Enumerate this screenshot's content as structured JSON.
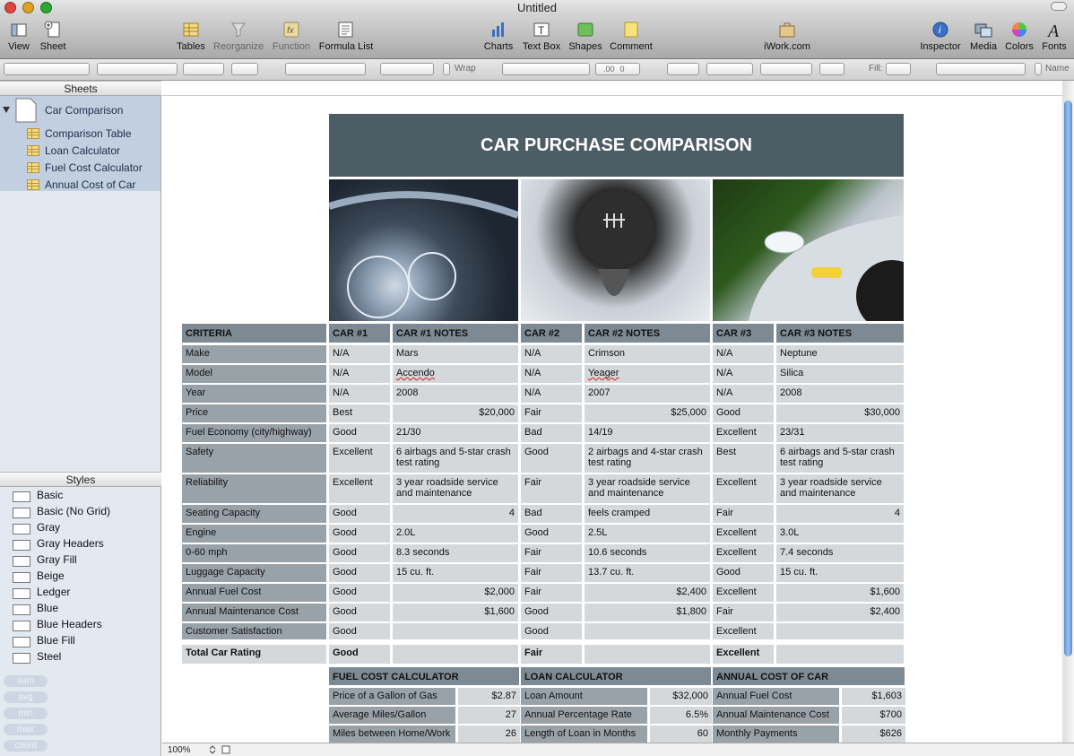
{
  "window": {
    "title": "Untitled"
  },
  "toolbar": {
    "view": "View",
    "sheet": "Sheet",
    "tables": "Tables",
    "reorganize": "Reorganize",
    "function": "Function",
    "formula_list": "Formula List",
    "charts": "Charts",
    "text_box": "Text Box",
    "shapes": "Shapes",
    "comment": "Comment",
    "iwork": "iWork.com",
    "inspector": "Inspector",
    "media": "Media",
    "colors": "Colors",
    "fonts": "Fonts"
  },
  "formatbar": {
    "wrap": "Wrap",
    "fill": "Fill:",
    "name": "Name",
    "decimals": "0",
    "dec_places": ".00"
  },
  "sidebar": {
    "sheets_header": "Sheets",
    "sheet_name": "Car Comparison",
    "tables": [
      "Comparison Table",
      "Loan Calculator",
      "Fuel Cost Calculator",
      "Annual Cost of Car"
    ],
    "styles_header": "Styles",
    "styles": [
      "Basic",
      "Basic (No Grid)",
      "Gray",
      "Gray Headers",
      "Gray Fill",
      "Beige",
      "Ledger",
      "Blue",
      "Blue Headers",
      "Blue Fill",
      "Steel"
    ],
    "functions": [
      "sum",
      "avg",
      "min",
      "max",
      "count"
    ]
  },
  "doc": {
    "title": "CAR PURCHASE COMPARISON",
    "headers": [
      "CRITERIA",
      "CAR #1",
      "CAR #1 NOTES",
      "CAR #2",
      "CAR #2 NOTES",
      "CAR #3",
      "CAR #3 NOTES"
    ],
    "rows": [
      {
        "criteria": "Make",
        "c1": "N/A",
        "n1": "Mars",
        "c2": "N/A",
        "n2": "Crimson",
        "c3": "N/A",
        "n3": "Neptune"
      },
      {
        "criteria": "Model",
        "c1": "N/A",
        "n1": "Accendo",
        "c2": "N/A",
        "n2": "Yeager",
        "c3": "N/A",
        "n3": "Silica"
      },
      {
        "criteria": "Year",
        "c1": "N/A",
        "n1": "2008",
        "c2": "N/A",
        "n2": "2007",
        "c3": "N/A",
        "n3": "2008"
      },
      {
        "criteria": "Price",
        "c1": "Best",
        "n1": "$20,000",
        "c2": "Fair",
        "n2": "$25,000",
        "c3": "Good",
        "n3": "$30,000"
      },
      {
        "criteria": "Fuel Economy (city/highway)",
        "c1": "Good",
        "n1": "21/30",
        "c2": "Bad",
        "n2": "14/19",
        "c3": "Excellent",
        "n3": "23/31"
      },
      {
        "criteria": "Safety",
        "c1": "Excellent",
        "n1": "6 airbags and 5-star crash test rating",
        "c2": "Good",
        "n2": "2 airbags and 4-star crash test rating",
        "c3": "Best",
        "n3": "6 airbags and 5-star crash test rating"
      },
      {
        "criteria": "Reliability",
        "c1": "Excellent",
        "n1": "3 year roadside service and maintenance",
        "c2": "Fair",
        "n2": "3 year roadside service and maintenance",
        "c3": "Excellent",
        "n3": "3 year roadside service and maintenance"
      },
      {
        "criteria": "Seating Capacity",
        "c1": "Good",
        "n1": "4",
        "c2": "Bad",
        "n2": "feels cramped",
        "c3": "Fair",
        "n3": "4"
      },
      {
        "criteria": "Engine",
        "c1": "Good",
        "n1": "2.0L",
        "c2": "Good",
        "n2": "2.5L",
        "c3": "Excellent",
        "n3": "3.0L"
      },
      {
        "criteria": "0-60 mph",
        "c1": "Good",
        "n1": "8.3 seconds",
        "c2": "Fair",
        "n2": "10.6 seconds",
        "c3": "Excellent",
        "n3": "7.4 seconds"
      },
      {
        "criteria": "Luggage Capacity",
        "c1": "Good",
        "n1": "15 cu. ft.",
        "c2": "Fair",
        "n2": "13.7 cu. ft.",
        "c3": "Good",
        "n3": "15 cu. ft."
      },
      {
        "criteria": "Annual Fuel Cost",
        "c1": "Good",
        "n1": "$2,000",
        "c2": "Fair",
        "n2": "$2,400",
        "c3": "Excellent",
        "n3": "$1,600"
      },
      {
        "criteria": "Annual Maintenance Cost",
        "c1": "Good",
        "n1": "$1,600",
        "c2": "Good",
        "n2": "$1,800",
        "c3": "Fair",
        "n3": "$2,400"
      },
      {
        "criteria": "Customer Satisfaction",
        "c1": "Good",
        "n1": "",
        "c2": "Good",
        "n2": "",
        "c3": "Excellent",
        "n3": ""
      }
    ],
    "total": {
      "criteria": "Total Car Rating",
      "c1": "Good",
      "c2": "Fair",
      "c3": "Excellent"
    },
    "fuel_calc": {
      "title": "FUEL COST CALCULATOR",
      "rows": [
        [
          "Price of a Gallon of Gas",
          "$2.87"
        ],
        [
          "Average Miles/Gallon",
          "27"
        ],
        [
          "Miles between Home/Work",
          "26"
        ]
      ]
    },
    "loan_calc": {
      "title": "LOAN CALCULATOR",
      "rows": [
        [
          "Loan Amount",
          "$32,000"
        ],
        [
          "Annual Percentage Rate",
          "6.5%"
        ],
        [
          "Length of Loan in Months",
          "60"
        ]
      ]
    },
    "annual_cost": {
      "title": "ANNUAL COST OF CAR",
      "rows": [
        [
          "Annual Fuel Cost",
          "$1,603"
        ],
        [
          "Annual Maintenance Cost",
          "$700"
        ],
        [
          "Monthly Payments",
          "$626"
        ]
      ]
    }
  },
  "status": {
    "zoom": "100%"
  },
  "colors": {
    "banner": "#4d5d66",
    "header": "#7d8a93",
    "criteria": "#9aa2a9",
    "value": "#d4d8db",
    "sidebar_selected": "#c2cfe0"
  }
}
